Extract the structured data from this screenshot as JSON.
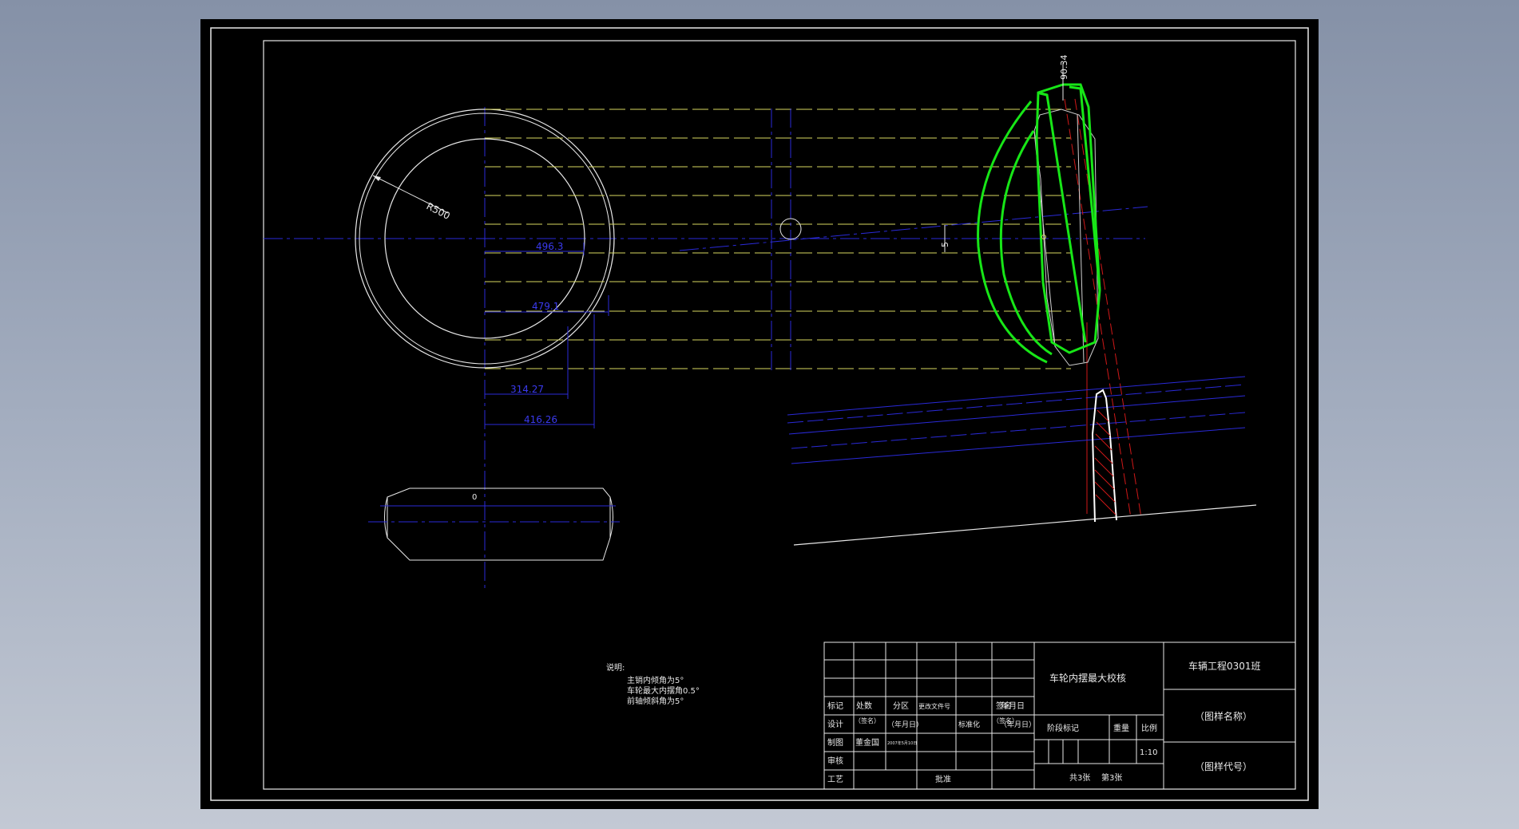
{
  "colors": {
    "background": "#000000",
    "frame": "#ffffff",
    "center_line": "#2a2ad8",
    "projection_line": "#d8d860",
    "outline": "#e8e8e8",
    "highlight": "#17e617",
    "section": "#d01818"
  },
  "dimensions": {
    "radius": "R500",
    "d1": "496.3",
    "d2": "479.1",
    "d3": "314.27",
    "d4": "416.26",
    "d5": "90.34",
    "d6": "5",
    "side_mark": "0"
  },
  "notes": {
    "heading": "说明:",
    "line1": "主销内倾角为5°",
    "line2": "车轮最大内摆角0.5°",
    "line3": "前轴倾斜角为5°"
  },
  "title_block": {
    "class_name": "车辆工程0301班",
    "drawing_title": "车轮内摆最大校核",
    "drawing_name": "（图样名称）",
    "drawing_code": "（图样代号）",
    "stage_mark": "阶段标记",
    "weight": "重量",
    "scale_label": "比例",
    "scale_value": "1:10",
    "sheets_total": "共3张",
    "sheet_no": "第3张",
    "mark": "标记",
    "count": "处数",
    "zone": "分区",
    "change_doc": "更改文件号",
    "sign": "签名",
    "date": "年月日",
    "design": "设计",
    "sign_placeholder": "（签名）",
    "date_placeholder": "（年月日）",
    "standardize": "标准化",
    "draw": "制图",
    "drawer_name": "董金国",
    "drawer_date": "2007年5月10日",
    "check": "审核",
    "process": "工艺",
    "approve": "批准"
  }
}
